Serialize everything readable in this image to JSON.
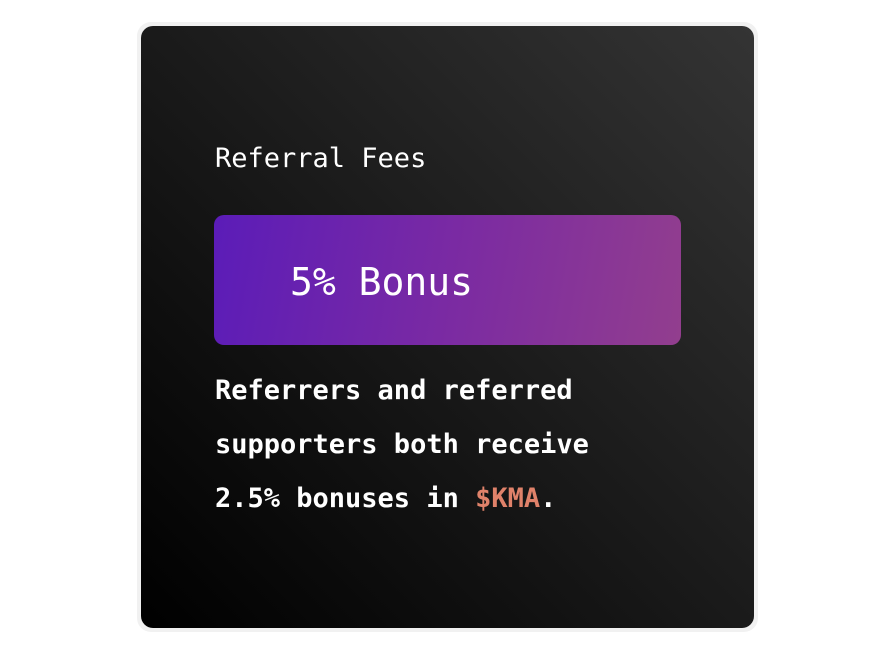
{
  "card": {
    "title": "Referral Fees",
    "bonus": "5% Bonus",
    "description": {
      "line1": "Referrers and referred",
      "line2": "supporters both receive",
      "line3_prefix": "2.5% bonuses in ",
      "token": "$KMA",
      "line3_suffix": "."
    }
  },
  "colors": {
    "card_bg": "#1a1a1a",
    "bonus_gradient_start": "#5b1cb8",
    "bonus_gradient_end": "#923e8e",
    "token_accent": "#e0826a"
  }
}
